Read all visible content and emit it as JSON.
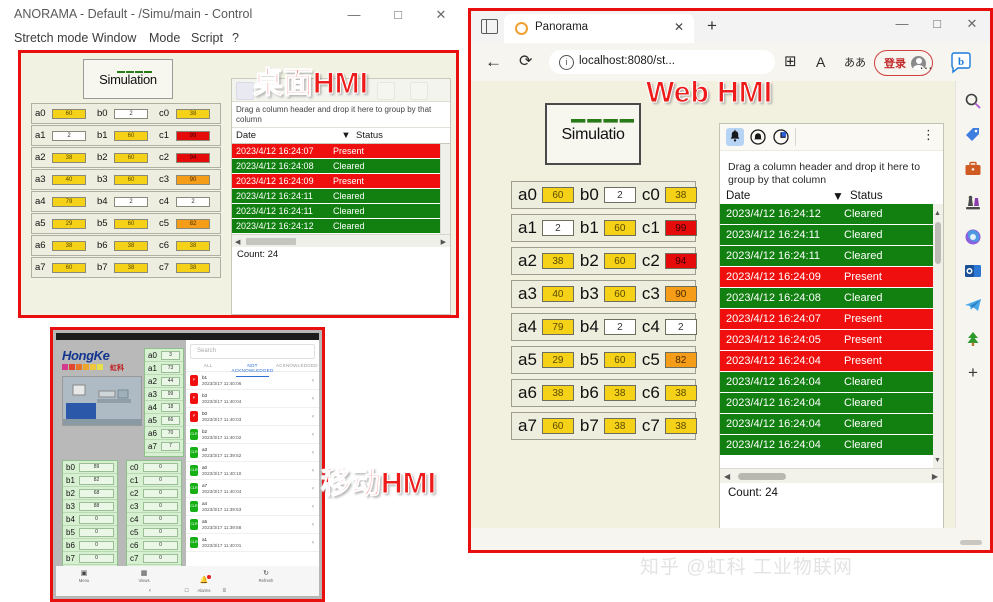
{
  "desktop": {
    "title": "ANORAMA - Default - /Simu/main - Control",
    "window_buttons": {
      "minimize": "—",
      "maximize": "□",
      "close": "✕"
    },
    "menu": [
      "Stretch mode",
      "Window",
      "Mode",
      "Script",
      "?"
    ],
    "sim_widget": {
      "label": "Simulation"
    },
    "tags": [
      {
        "a_label": "a0",
        "a_value": "60",
        "a_state": "yellow",
        "b_label": "b0",
        "b_value": "2",
        "b_state": "white",
        "c_label": "c0",
        "c_value": "38",
        "c_state": "yellow"
      },
      {
        "a_label": "a1",
        "a_value": "2",
        "a_state": "white",
        "b_label": "b1",
        "b_value": "60",
        "b_state": "yellow",
        "c_label": "c1",
        "c_value": "99",
        "c_state": "red"
      },
      {
        "a_label": "a2",
        "a_value": "38",
        "a_state": "yellow",
        "b_label": "b2",
        "b_value": "60",
        "b_state": "yellow",
        "c_label": "c2",
        "c_value": "94",
        "c_state": "red"
      },
      {
        "a_label": "a3",
        "a_value": "40",
        "a_state": "yellow",
        "b_label": "b3",
        "b_value": "60",
        "b_state": "yellow",
        "c_label": "c3",
        "c_value": "90",
        "c_state": "orange"
      },
      {
        "a_label": "a4",
        "a_value": "79",
        "a_state": "yellow",
        "b_label": "b4",
        "b_value": "2",
        "b_state": "white",
        "c_label": "c4",
        "c_value": "2",
        "c_state": "white"
      },
      {
        "a_label": "a5",
        "a_value": "29",
        "a_state": "yellow",
        "b_label": "b5",
        "b_value": "60",
        "b_state": "yellow",
        "c_label": "c5",
        "c_value": "82",
        "c_state": "orange"
      },
      {
        "a_label": "a6",
        "a_value": "38",
        "a_state": "yellow",
        "b_label": "b6",
        "b_value": "38",
        "b_state": "yellow",
        "c_label": "c6",
        "c_value": "38",
        "c_state": "yellow"
      },
      {
        "a_label": "a7",
        "a_value": "60",
        "a_state": "yellow",
        "b_label": "b7",
        "b_value": "38",
        "b_state": "yellow",
        "c_label": "c7",
        "c_value": "38",
        "c_state": "yellow"
      }
    ],
    "alarm": {
      "group_hint": "Drag a column header and drop it here to group by that column",
      "col_date": "Date",
      "col_status": "Status",
      "rows": [
        {
          "date": "2023/4/12 16:24:12",
          "status": "Cleared",
          "state": "green"
        },
        {
          "date": "2023/4/12 16:24:11",
          "status": "Cleared",
          "state": "green"
        },
        {
          "date": "2023/4/12 16:24:11",
          "status": "Cleared",
          "state": "green"
        },
        {
          "date": "2023/4/12 16:24:09",
          "status": "Present",
          "state": "red"
        },
        {
          "date": "2023/4/12 16:24:08",
          "status": "Cleared",
          "state": "green"
        },
        {
          "date": "2023/4/12 16:24:07",
          "status": "Present",
          "state": "red"
        }
      ],
      "count": "Count: 24"
    }
  },
  "annotations": {
    "desktop": "桌面HMI",
    "web": "Web HMI",
    "mobile": "移动HMI"
  },
  "edge": {
    "tab_title": "Panorama",
    "tab_close": "✕",
    "new_tab": "+",
    "back": "←",
    "refresh": "⟳",
    "url": "localhost:8080/st...",
    "url_info": "i",
    "collections": "⊞",
    "read_aloud": "A",
    "translate": "ああ",
    "favorite": "☆",
    "login_label": "登录",
    "more": "…",
    "window_buttons": {
      "minimize": "—",
      "maximize": "□",
      "close": "✕"
    },
    "sidebar_icons": [
      "copilot-icon",
      "search-icon",
      "shopping-tag-icon",
      "tools-icon",
      "games-icon",
      "office-icon",
      "outlook-icon",
      "telegram-icon",
      "tree-icon",
      "add-icon"
    ],
    "sidebar_add": "+"
  },
  "web": {
    "sim_widget": {
      "label": "Simulatio"
    },
    "tags": [
      {
        "a_label": "a0",
        "a_value": "60",
        "a_state": "yellow",
        "b_label": "b0",
        "b_value": "2",
        "b_state": "white",
        "c_label": "c0",
        "c_value": "38",
        "c_state": "yellow"
      },
      {
        "a_label": "a1",
        "a_value": "2",
        "a_state": "white",
        "b_label": "b1",
        "b_value": "60",
        "b_state": "yellow",
        "c_label": "c1",
        "c_value": "99",
        "c_state": "red"
      },
      {
        "a_label": "a2",
        "a_value": "38",
        "a_state": "yellow",
        "b_label": "b2",
        "b_value": "60",
        "b_state": "yellow",
        "c_label": "c2",
        "c_value": "94",
        "c_state": "red"
      },
      {
        "a_label": "a3",
        "a_value": "40",
        "a_state": "yellow",
        "b_label": "b3",
        "b_value": "60",
        "b_state": "yellow",
        "c_label": "c3",
        "c_value": "90",
        "c_state": "orange"
      },
      {
        "a_label": "a4",
        "a_value": "79",
        "a_state": "yellow",
        "b_label": "b4",
        "b_value": "2",
        "b_state": "white",
        "c_label": "c4",
        "c_value": "2",
        "c_state": "white"
      },
      {
        "a_label": "a5",
        "a_value": "29",
        "a_state": "yellow",
        "b_label": "b5",
        "b_value": "60",
        "b_state": "yellow",
        "c_label": "c5",
        "c_value": "82",
        "c_state": "orange"
      },
      {
        "a_label": "a6",
        "a_value": "38",
        "a_state": "yellow",
        "b_label": "b6",
        "b_value": "38",
        "b_state": "yellow",
        "c_label": "c6",
        "c_value": "38",
        "c_state": "yellow"
      },
      {
        "a_label": "a7",
        "a_value": "60",
        "a_state": "yellow",
        "b_label": "b7",
        "b_value": "38",
        "b_state": "yellow",
        "c_label": "c7",
        "c_value": "38",
        "c_state": "yellow"
      }
    ],
    "alarm": {
      "group_hint": "Drag a column header and drop it here to group by that column",
      "col_date": "Date",
      "col_status": "Status",
      "menu_dots": "⋮",
      "rows": [
        {
          "date": "2023/4/12 16:24:12",
          "status": "Cleared",
          "state": "green"
        },
        {
          "date": "2023/4/12 16:24:11",
          "status": "Cleared",
          "state": "green"
        },
        {
          "date": "2023/4/12 16:24:11",
          "status": "Cleared",
          "state": "green"
        },
        {
          "date": "2023/4/12 16:24:09",
          "status": "Present",
          "state": "red"
        },
        {
          "date": "2023/4/12 16:24:08",
          "status": "Cleared",
          "state": "green"
        },
        {
          "date": "2023/4/12 16:24:07",
          "status": "Present",
          "state": "red"
        },
        {
          "date": "2023/4/12 16:24:05",
          "status": "Present",
          "state": "red"
        },
        {
          "date": "2023/4/12 16:24:04",
          "status": "Present",
          "state": "red"
        },
        {
          "date": "2023/4/12 16:24:04",
          "status": "Cleared",
          "state": "green"
        },
        {
          "date": "2023/4/12 16:24:04",
          "status": "Cleared",
          "state": "green"
        },
        {
          "date": "2023/4/12 16:24:04",
          "status": "Cleared",
          "state": "green"
        },
        {
          "date": "2023/4/12 16:24:04",
          "status": "Cleared",
          "state": "green"
        }
      ],
      "count": "Count: 24"
    }
  },
  "mobile": {
    "brand": "HongKe",
    "brand_cn": "虹科",
    "search_placeholder": "Search",
    "tabs": [
      {
        "label": "ALL",
        "active": false
      },
      {
        "label": "NOT ACKNOWLEDGED",
        "active": true
      },
      {
        "label": "ACKNOWLEDGED",
        "active": false
      }
    ],
    "col_a": [
      {
        "label": "a0",
        "value": "3"
      },
      {
        "label": "a1",
        "value": "73"
      },
      {
        "label": "a2",
        "value": "44"
      },
      {
        "label": "a3",
        "value": "99"
      },
      {
        "label": "a4",
        "value": "18"
      },
      {
        "label": "a5",
        "value": "66"
      },
      {
        "label": "a6",
        "value": "70"
      },
      {
        "label": "a7",
        "value": "7"
      }
    ],
    "col_b": [
      {
        "label": "b0",
        "value": "89"
      },
      {
        "label": "b1",
        "value": "82"
      },
      {
        "label": "b2",
        "value": "68"
      },
      {
        "label": "b3",
        "value": "88"
      },
      {
        "label": "b4",
        "value": "0"
      },
      {
        "label": "b5",
        "value": "0"
      },
      {
        "label": "b6",
        "value": "0"
      },
      {
        "label": "b7",
        "value": "0"
      }
    ],
    "col_c": [
      {
        "label": "c0",
        "value": "0"
      },
      {
        "label": "c1",
        "value": "0"
      },
      {
        "label": "c2",
        "value": "0"
      },
      {
        "label": "c3",
        "value": "0"
      },
      {
        "label": "c4",
        "value": "0"
      },
      {
        "label": "c5",
        "value": "0"
      },
      {
        "label": "c6",
        "value": "0"
      },
      {
        "label": "c7",
        "value": "0"
      }
    ],
    "alarms": [
      {
        "name": "b1",
        "time": "2023/3/17 11:40:06",
        "state": "red",
        "badge": "P",
        "chevron": "‹"
      },
      {
        "name": "b3",
        "time": "2023/3/17 11:40:04",
        "state": "red",
        "badge": "P",
        "chevron": "‹"
      },
      {
        "name": "b0",
        "time": "2023/3/17 11:40:03",
        "state": "red",
        "badge": "P",
        "chevron": "‹"
      },
      {
        "name": "b2",
        "time": "2023/3/17 11:40:02",
        "state": "green",
        "badge": "CLR",
        "chevron": "‹"
      },
      {
        "name": "a3",
        "time": "2023/3/17 11:39:52",
        "state": "green",
        "badge": "CLR",
        "chevron": "‹"
      },
      {
        "name": "a0",
        "time": "2023/3/17 11:40:10",
        "state": "green",
        "badge": "CLR",
        "chevron": "‹"
      },
      {
        "name": "a7",
        "time": "2023/3/17 11:40:04",
        "state": "green",
        "badge": "CLR",
        "chevron": "‹"
      },
      {
        "name": "a4",
        "time": "2023/3/17 11:39:53",
        "state": "green",
        "badge": "CLR",
        "chevron": "‹"
      },
      {
        "name": "a5",
        "time": "2023/3/17 11:39:58",
        "state": "green",
        "badge": "CLR",
        "chevron": "‹"
      },
      {
        "name": "a1",
        "time": "2023/3/17 11:40:01",
        "state": "green",
        "badge": "CLR",
        "chevron": "‹"
      }
    ],
    "nav": [
      {
        "icon": "menu-icon",
        "label": "Menu"
      },
      {
        "icon": "views-icon",
        "label": "Views"
      },
      {
        "icon": "alarms-icon",
        "label": "Alarms"
      },
      {
        "icon": "refresh-icon",
        "label": "Refresh"
      }
    ],
    "sysnav": [
      "‹",
      "□",
      "≡"
    ]
  },
  "watermark": "知乎 @虹科 工业物联网",
  "colors": {
    "accent_red": "#e8100f",
    "alarm_green": "#118011",
    "alarm_red": "#ef0f0f",
    "tag_yellow": "#f5d117",
    "tag_orange": "#f59c18",
    "tag_red": "#e60b0b",
    "hmi_bg": "#f2f1e0"
  }
}
